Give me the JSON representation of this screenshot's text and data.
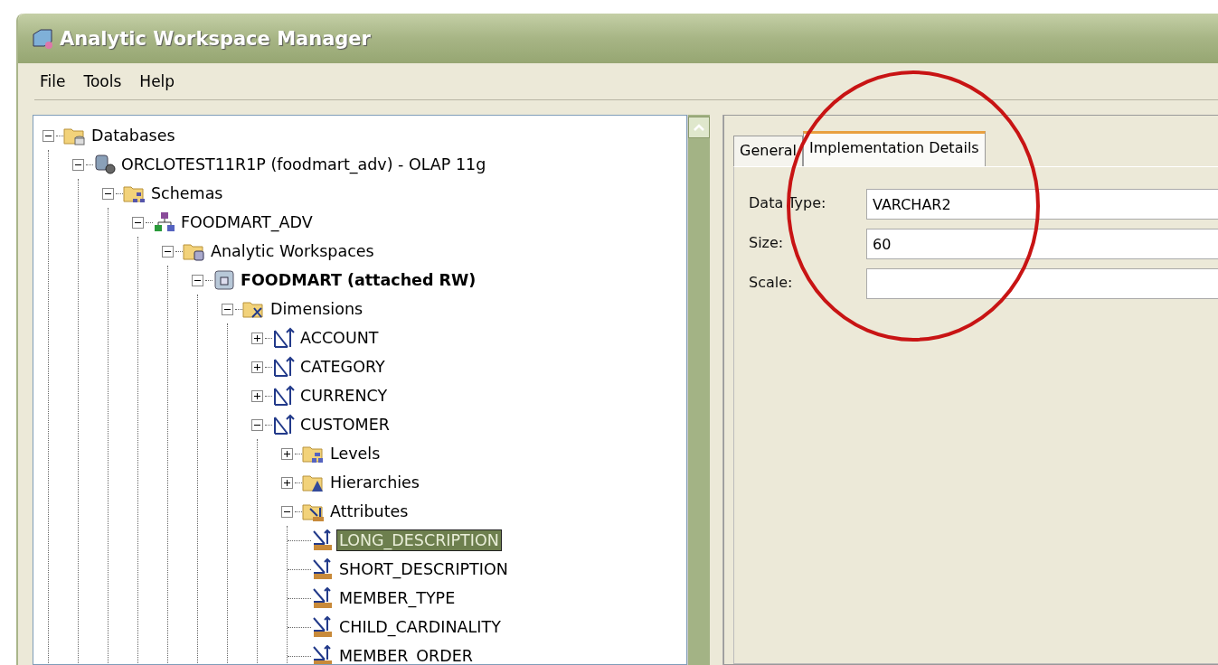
{
  "window": {
    "title": "Analytic Workspace Manager"
  },
  "menu": [
    "File",
    "Tools",
    "Help"
  ],
  "tree": [
    {
      "label": "Databases",
      "kind": "databases",
      "expanded": true,
      "children": [
        {
          "label": "ORCLOTEST11R1P (foodmart_adv) - OLAP 11g",
          "kind": "server",
          "expanded": true,
          "children": [
            {
              "label": "Schemas",
              "kind": "schemas",
              "expanded": true,
              "children": [
                {
                  "label": "FOODMART_ADV",
                  "kind": "schema",
                  "expanded": true,
                  "children": [
                    {
                      "label": "Analytic Workspaces",
                      "kind": "workspaces",
                      "expanded": true,
                      "children": [
                        {
                          "label": "FOODMART (attached RW)",
                          "kind": "workspace",
                          "bold": true,
                          "expanded": true,
                          "children": [
                            {
                              "label": "Dimensions",
                              "kind": "dimensions",
                              "expanded": true,
                              "children": [
                                {
                                  "label": "ACCOUNT",
                                  "kind": "dimension",
                                  "expanded": false
                                },
                                {
                                  "label": "CATEGORY",
                                  "kind": "dimension",
                                  "expanded": false
                                },
                                {
                                  "label": "CURRENCY",
                                  "kind": "dimension",
                                  "expanded": false
                                },
                                {
                                  "label": "CUSTOMER",
                                  "kind": "dimension",
                                  "expanded": true,
                                  "children": [
                                    {
                                      "label": "Levels",
                                      "kind": "levels",
                                      "expanded": false
                                    },
                                    {
                                      "label": "Hierarchies",
                                      "kind": "hierarchies",
                                      "expanded": false
                                    },
                                    {
                                      "label": "Attributes",
                                      "kind": "attributes",
                                      "expanded": true,
                                      "children": [
                                        {
                                          "label": "LONG_DESCRIPTION",
                                          "kind": "attribute",
                                          "selected": true
                                        },
                                        {
                                          "label": "SHORT_DESCRIPTION",
                                          "kind": "attribute",
                                          "selected": false
                                        },
                                        {
                                          "label": "MEMBER_TYPE",
                                          "kind": "attribute",
                                          "selected": false
                                        },
                                        {
                                          "label": "CHILD_CARDINALITY",
                                          "kind": "attribute",
                                          "selected": false
                                        },
                                        {
                                          "label": "MEMBER_ORDER",
                                          "kind": "attribute",
                                          "selected": false
                                        }
                                      ]
                                    }
                                  ]
                                }
                              ]
                            }
                          ]
                        }
                      ]
                    }
                  ]
                }
              ]
            }
          ]
        }
      ]
    }
  ],
  "tabs": [
    {
      "label": "General",
      "selected": false
    },
    {
      "label": "Implementation Details",
      "selected": true
    }
  ],
  "fields": [
    {
      "label": "Data Type:",
      "value": "VARCHAR2"
    },
    {
      "label": "Size:",
      "value": "60"
    },
    {
      "label": "Scale:"
    }
  ],
  "annotation": {
    "kind": "circle"
  }
}
